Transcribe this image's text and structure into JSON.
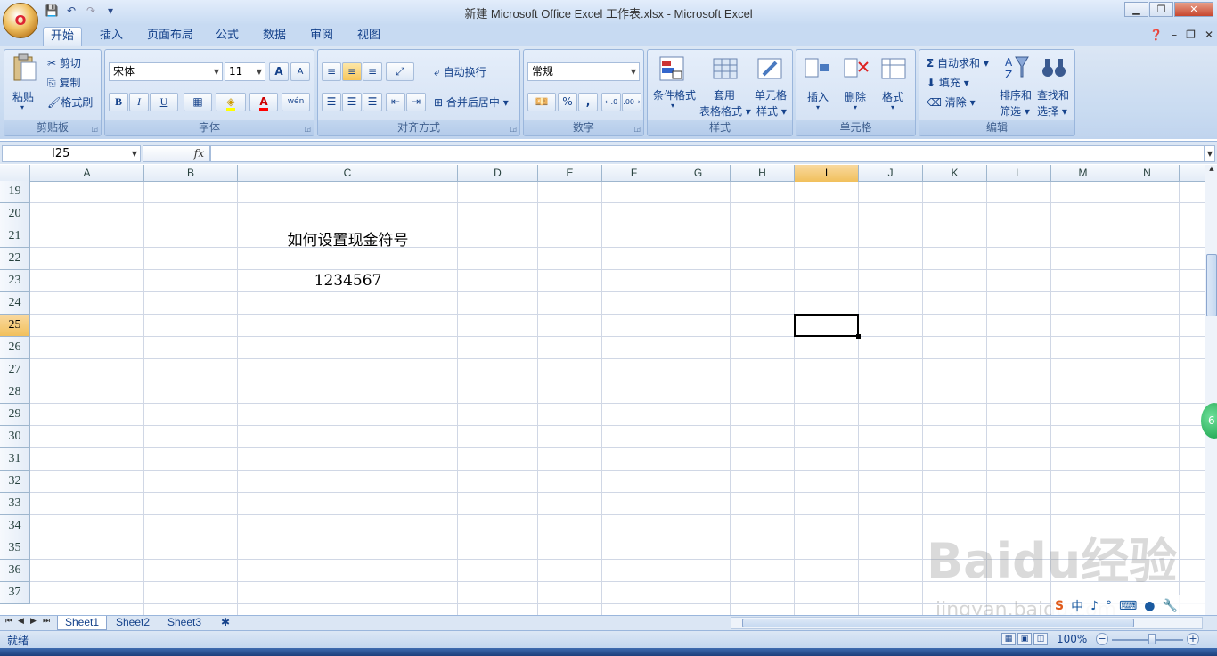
{
  "window": {
    "title": "新建 Microsoft Office Excel 工作表.xlsx - Microsoft Excel",
    "office_button_glyph": "O"
  },
  "tabs": [
    "开始",
    "插入",
    "页面布局",
    "公式",
    "数据",
    "审阅",
    "视图"
  ],
  "ribbon": {
    "clipboard": {
      "label": "剪贴板",
      "paste": "粘贴",
      "cut": "剪切",
      "copy": "复制",
      "format_painter": "格式刷"
    },
    "font": {
      "label": "字体",
      "font_name": "宋体",
      "font_size": "11",
      "bold": "B",
      "italic": "I",
      "underline": "U",
      "grow": "A",
      "shrink": "A",
      "font_color": "A",
      "phonetic": "wén"
    },
    "alignment": {
      "label": "对齐方式",
      "wrap_text": "自动换行",
      "merge_center": "合并后居中"
    },
    "number": {
      "label": "数字",
      "format": "常规",
      "percent": "%",
      "comma": ","
    },
    "styles": {
      "label": "样式",
      "conditional_formatting": "条件格式",
      "format_as_table_1": "套用",
      "format_as_table_2": "表格格式",
      "cell_styles_1": "单元格",
      "cell_styles_2": "样式"
    },
    "cells": {
      "label": "单元格",
      "insert": "插入",
      "delete": "删除",
      "format": "格式"
    },
    "editing": {
      "label": "编辑",
      "autosum": "自动求和",
      "fill": "填充",
      "clear": "清除",
      "sort_1": "排序和",
      "sort_2": "筛选",
      "find_1": "查找和",
      "find_2": "选择"
    }
  },
  "formula_bar": {
    "name_box": "I25",
    "fx": "fx",
    "formula": ""
  },
  "columns": [
    "A",
    "B",
    "C",
    "D",
    "E",
    "F",
    "G",
    "H",
    "I",
    "J",
    "K",
    "L",
    "M",
    "N"
  ],
  "rows": [
    "19",
    "20",
    "21",
    "22",
    "23",
    "24",
    "25",
    "26",
    "27",
    "28",
    "29",
    "30",
    "31",
    "32",
    "33",
    "34",
    "35",
    "36",
    "37"
  ],
  "selected_cell": {
    "column": "I",
    "row": "25"
  },
  "cells": [
    {
      "ref": "C21",
      "value": "如何设置现金符号"
    },
    {
      "ref": "C23",
      "value": "1234567"
    }
  ],
  "sheets": [
    "Sheet1",
    "Sheet2",
    "Sheet3"
  ],
  "active_sheet": "Sheet1",
  "status": {
    "mode": "就绪",
    "zoom": "100%"
  },
  "watermark": {
    "logo": "Baidu经验",
    "url": "jingyan.baidu.com"
  },
  "ime": {
    "mode": "中"
  },
  "colors": {
    "selection_header": "#f1c05c",
    "ribbon_bg": "#c9dbf1",
    "grid_line": "#d0d7e5"
  }
}
